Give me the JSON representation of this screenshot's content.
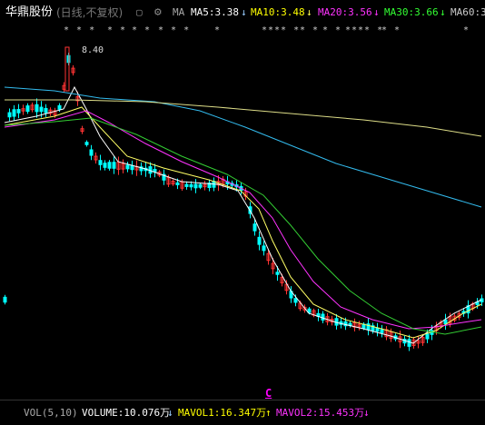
{
  "header": {
    "stock_name": "华鼎股份",
    "mode": "(日线,不复权)",
    "ma_label": "MA",
    "ma5": "MA5:3.38",
    "ma5_dir": "↓",
    "ma10": "MA10:3.48",
    "ma10_dir": "↓",
    "ma20": "MA20:3.56",
    "ma20_dir": "↓",
    "ma30": "MA30:3.66",
    "ma30_dir": "↓",
    "ma60": "MA60:3.",
    "colors": {
      "ma5": "#ffffff",
      "ma10": "#ffff00",
      "ma20": "#ff33ff",
      "ma30": "#33ff33",
      "ma60": "#cccccc"
    }
  },
  "markers": [
    "* * *",
    "* *",
    "* *",
    "* * *",
    "*",
    "**** *",
    "* *",
    "* *",
    "**** *",
    "* *",
    "*"
  ],
  "peak_label": "8.40",
  "c_marker": "C",
  "volume": {
    "label": "VOL(5,10)",
    "volume": "VOLUME:10.076万",
    "volume_dir": "↓",
    "mavol1": "MAVOL1:16.347万",
    "mavol1_dir": "↑",
    "mavol2": "MAVOL2:15.453万",
    "mavol2_dir": "↓"
  },
  "colors": {
    "up": "#ff3333",
    "down": "#00ffff",
    "ma5_line": "#ffffff",
    "ma10_line": "#ffff66",
    "ma20_line": "#ff33ff",
    "ma30_line": "#33cc33",
    "ma60_line": "#33bbee",
    "ma120_line": "#dddd88"
  }
}
